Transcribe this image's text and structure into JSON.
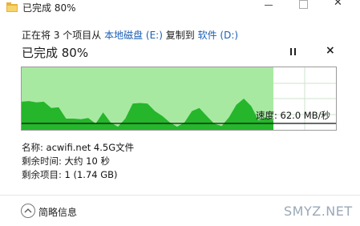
{
  "window": {
    "title": "已完成 80%",
    "minimize_symbol": "—",
    "close_symbol": "✕"
  },
  "copy": {
    "prefix": "正在将 3 个项目从",
    "source": "本地磁盘 (E:)",
    "middle": "复制到",
    "destination": "软件 (D:)"
  },
  "progress": {
    "title": "已完成 80%",
    "percent": 80,
    "pause_icon": "pause-icon",
    "cancel_symbol": "×",
    "speed_label": "速度: 62.0 MB/秒",
    "speed_line_level": 0.1,
    "throughput_profile": [
      0.45,
      0.46,
      0.44,
      0.45,
      0.35,
      0.36,
      0.18,
      0.18,
      0.17,
      0.19,
      0.1,
      0.28,
      0.12,
      0.05,
      0.18,
      0.42,
      0.43,
      0.42,
      0.3,
      0.22,
      0.12,
      0.05,
      0.12,
      0.3,
      0.35,
      0.22,
      0.1,
      0.06,
      0.2,
      0.4,
      0.5,
      0.38,
      0.15,
      0.2,
      0.15
    ]
  },
  "details": {
    "name_label": "名称: ",
    "name_value": "acwifi.net 4.5G文件",
    "time_label": "剩余时间: ",
    "time_value": "大约 10 秒",
    "items_label": "剩余项目: ",
    "items_value": "1 (1.74 GB)"
  },
  "footer": {
    "less_label": "简略信息",
    "watermark": "SMYZ.NET"
  },
  "colors": {
    "fill_light": "#a8e9a2",
    "fill_dark": "#25b62b",
    "link": "#1a5fb4",
    "grid": "#cfe3cf"
  }
}
